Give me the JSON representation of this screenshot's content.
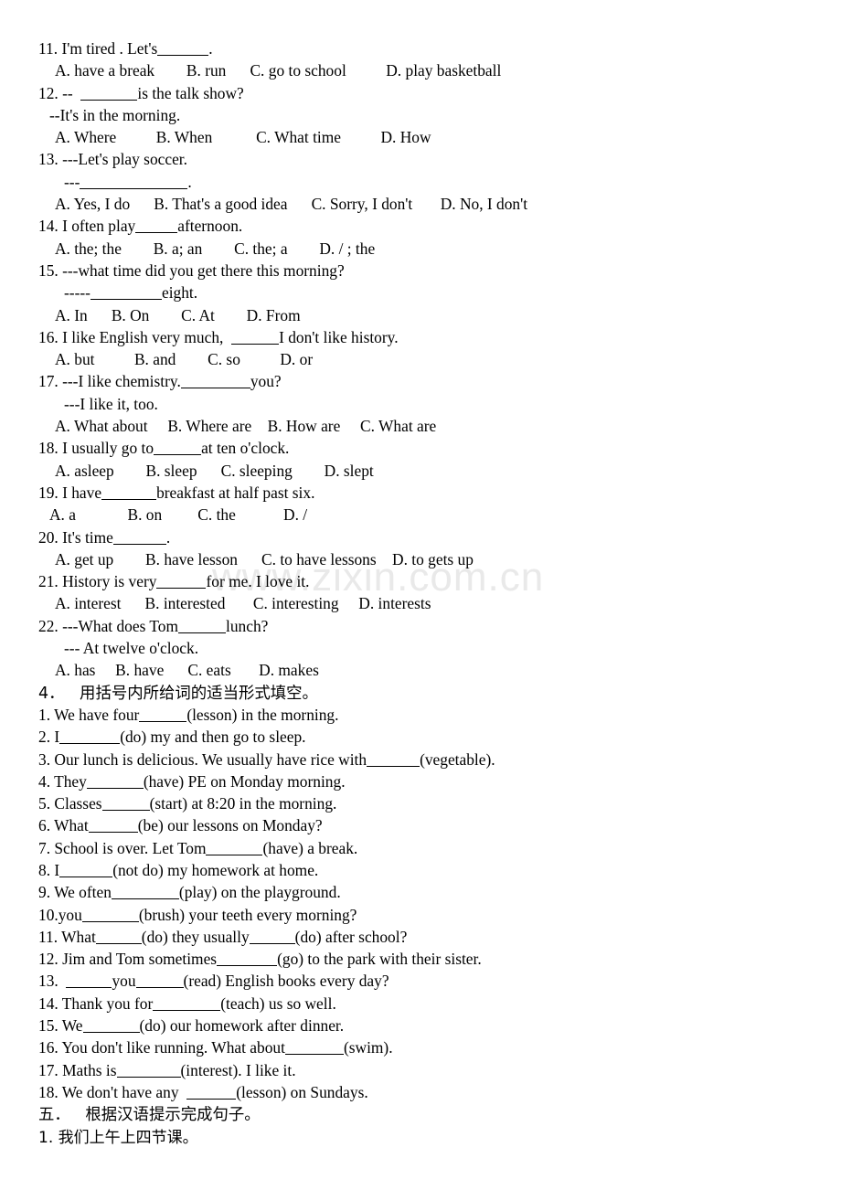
{
  "watermark": {
    "text": "www.zixin.com.cn"
  },
  "document": {
    "type": "english-exam-worksheet",
    "multiple_choice": [
      {
        "number": "11.",
        "stem_before": "11. I'm tired . Let's",
        "stem_after": ".",
        "blank_width": 56,
        "options_line": "A. have a break        B. run      C. go to school          D. play basketball",
        "extra_lines": []
      },
      {
        "number": "12.",
        "stem_before": "12. --  ",
        "stem_after": "is the talk show?",
        "blank_width": 62,
        "options_line": "A. Where          B. When           C. What time          D. How",
        "extra_lines": [
          "--It's in the morning."
        ]
      },
      {
        "number": "13.",
        "stem_before": "13. ---Let's play soccer.",
        "stem_after": "",
        "blank_width": 0,
        "options_line": "A. Yes, I do      B. That's a good idea      C. Sorry, I don't       D. No, I don't",
        "extra_lines": [
          "---",
          "."
        ]
      },
      {
        "number": "14.",
        "stem_before": "14. I often play",
        "stem_after": "afternoon.",
        "blank_width": 46,
        "options_line": "A. the; the        B. a; an        C. the; a        D. / ; the",
        "extra_lines": []
      },
      {
        "number": "15.",
        "stem_before": "15. ---what time did you get there this morning?",
        "stem_after": "eight.",
        "blank_width": 78,
        "options_line": "A. In      B. On        C. At        D. From",
        "extra_lines": [
          "-----"
        ]
      },
      {
        "number": "16.",
        "stem_before": "16. I like English very much,  ",
        "stem_after": "I don't like history.",
        "blank_width": 52,
        "options_line": "A. but          B. and        C. so          D. or",
        "extra_lines": []
      },
      {
        "number": "17.",
        "stem_before": "17. ---I like chemistry.",
        "stem_after": "you?",
        "blank_width": 76,
        "options_line": "A. What about     B. Where are    B. How are     C. What are",
        "extra_lines": [
          "---I like it, too."
        ]
      },
      {
        "number": "18.",
        "stem_before": "18. I usually go to",
        "stem_after": "at ten o'clock.",
        "blank_width": 52,
        "options_line": "A. asleep        B. sleep      C. sleeping        D. slept",
        "extra_lines": []
      },
      {
        "number": "19.",
        "stem_before": "19. I have",
        "stem_after": "breakfast at half past six.",
        "blank_width": 60,
        "options_line": "A. a             B. on         C. the            D. /",
        "extra_lines": []
      },
      {
        "number": "20.",
        "stem_before": "20. It's time",
        "stem_after": ".",
        "blank_width": 58,
        "options_line": "A. get up        B. have lesson      C. to have lessons    D. to gets up",
        "extra_lines": []
      },
      {
        "number": "21.",
        "stem_before": "21. History is very",
        "stem_after": "for me. I love it.",
        "blank_width": 54,
        "options_line": "A. interest      B. interested       C. interesting     D. interests",
        "extra_lines": []
      },
      {
        "number": "22.",
        "stem_before": "22. ---What does Tom",
        "stem_after": "lunch?",
        "blank_width": 52,
        "options_line": "A. has     B. have      C. eats       D. makes",
        "extra_lines": [
          "--- At twelve o'clock."
        ]
      }
    ],
    "section_four": {
      "heading_number": "4．",
      "heading_text": "用括号内所给词的适当形式填空。",
      "items": [
        {
          "prefix": "1. We have four",
          "b1": 52,
          "suffix": "(lesson) in the morning."
        },
        {
          "prefix": "2. I",
          "b1": 66,
          "suffix": "(do) my and then go to sleep."
        },
        {
          "prefix": "3. Our lunch is delicious. We usually have rice with",
          "b1": 58,
          "suffix": "(vegetable)."
        },
        {
          "prefix": "4. They",
          "b1": 62,
          "suffix": "(have) PE on Monday morning."
        },
        {
          "prefix": "5. Classes",
          "b1": 52,
          "suffix": "(start) at 8:20 in the morning."
        },
        {
          "prefix": "6. What",
          "b1": 54,
          "suffix": "(be) our lessons on Monday?"
        },
        {
          "prefix": "7. School is over. Let Tom",
          "b1": 62,
          "suffix": "(have) a break."
        },
        {
          "prefix": "8. I",
          "b1": 58,
          "suffix": "(not do) my homework at home."
        },
        {
          "prefix": "9. We often",
          "b1": 74,
          "suffix": "(play) on the playground."
        },
        {
          "prefix": "10.you",
          "b1": 62,
          "suffix": "(brush) your teeth every morning?"
        },
        {
          "prefix": "11. What",
          "b1": 50,
          "mid": "(do) they usually",
          "b2": 50,
          "suffix": "(do) after school?"
        },
        {
          "prefix": "12. Jim and Tom sometimes",
          "b1": 66,
          "suffix": "(go) to the park with their sister."
        },
        {
          "prefix": "13.  ",
          "b1": 50,
          "mid": "you",
          "b2": 52,
          "suffix": "(read) English books every day?"
        },
        {
          "prefix": "14. Thank you for",
          "b1": 74,
          "suffix": "(teach) us so well."
        },
        {
          "prefix": "15. We",
          "b1": 62,
          "suffix": "(do) our homework after dinner."
        },
        {
          "prefix": "16. You don't like running. What about",
          "b1": 64,
          "suffix": "(swim)."
        },
        {
          "prefix": "17. Maths is",
          "b1": 70,
          "suffix": "(interest). I like it."
        },
        {
          "prefix": "18. We don't have any  ",
          "b1": 54,
          "suffix": "(lesson) on Sundays."
        }
      ]
    },
    "section_five": {
      "heading_number": "五．",
      "heading_text": "根据汉语提示完成句子。",
      "items": [
        {
          "text": "1. 我们上午上四节课。"
        }
      ]
    }
  }
}
